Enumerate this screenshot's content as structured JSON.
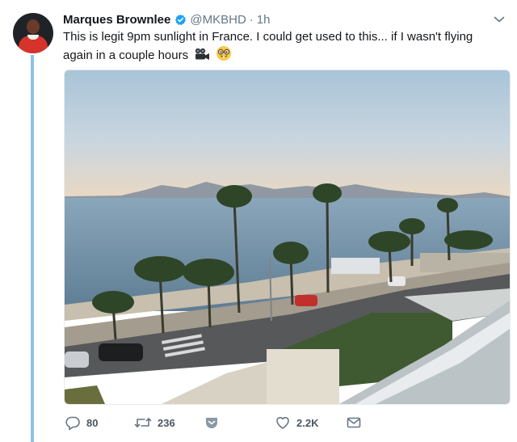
{
  "tweet": {
    "author_name": "Marques Brownlee",
    "handle": "@MKBHD",
    "separator": "·",
    "time": "1h",
    "text": "This is legit 9pm sunlight in France. I could get used to this... if I wasn't flying again in a couple hours",
    "emojis": [
      "movie-camera-emoji",
      "nerd-face-emoji"
    ],
    "verified": true
  },
  "actions": {
    "reply_count": "80",
    "retweet_count": "236",
    "like_count": "2.2K"
  },
  "colors": {
    "accent": "#1da1f2",
    "thread_line": "#8ec2e8",
    "muted": "#657786"
  }
}
